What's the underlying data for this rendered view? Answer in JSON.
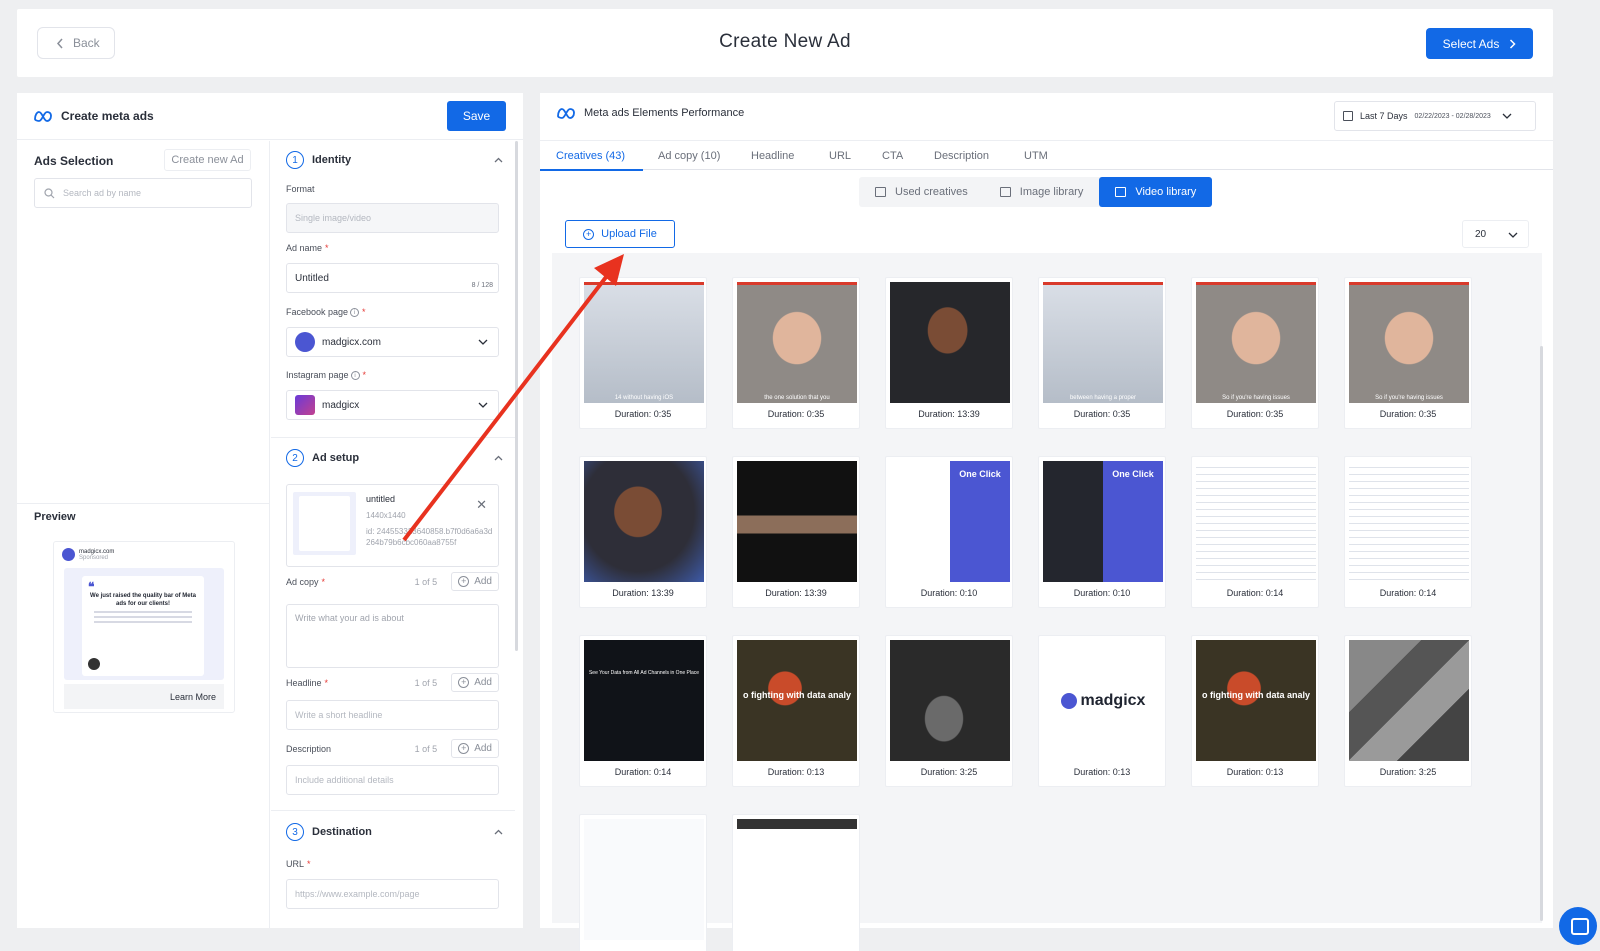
{
  "header": {
    "back_label": "Back",
    "title": "Create New Ad",
    "select_ads_label": "Select Ads"
  },
  "left_panel": {
    "title": "Create meta ads",
    "save_label": "Save",
    "ads_selection_label": "Ads Selection",
    "create_new_label": "Create new Ad",
    "search_placeholder": "Search ad by name",
    "preview_label": "Preview",
    "preview": {
      "page_name": "madgicx.com",
      "sub": "Sponsored",
      "headline": "We just raised the quality bar of Meta ads for our clients!",
      "learn_more": "Learn More"
    }
  },
  "form": {
    "identity": {
      "num": "1",
      "title": "Identity",
      "format_label": "Format",
      "format_value": "Single image/video",
      "ad_name_label": "Ad name",
      "ad_name_value": "Untitled",
      "ad_name_counter": "8 / 128",
      "facebook_label": "Facebook page",
      "facebook_value": "madgicx.com",
      "instagram_label": "Instagram page",
      "instagram_value": "madgicx"
    },
    "ad_setup": {
      "num": "2",
      "title": "Ad setup",
      "creative": {
        "name": "untitled",
        "size": "1440x1440",
        "id": "id: 244553323640858.b7f0d6a6a3d264b79b6cbc060aa8755f"
      },
      "ad_copy_label": "Ad copy",
      "ad_copy_count": "1 of 5",
      "ad_copy_placeholder": "Write what your ad is about",
      "headline_label": "Headline",
      "headline_count": "1 of 5",
      "headline_placeholder": "Write a short headline",
      "description_label": "Description",
      "description_count": "1 of 5",
      "description_placeholder": "Include additional details",
      "add_label": "Add"
    },
    "destination": {
      "num": "3",
      "title": "Destination",
      "url_label": "URL",
      "url_placeholder": "https://www.example.com/page"
    }
  },
  "right_panel": {
    "title": "Meta ads Elements Performance",
    "date_label": "Last 7 Days",
    "date_range": "02/22/2023 - 02/28/2023",
    "tabs": [
      "Creatives (43)",
      "Ad copy (10)",
      "Headline",
      "URL",
      "CTA",
      "Description",
      "UTM"
    ],
    "active_tab": "Creatives (43)",
    "segments": [
      "Used creatives",
      "Image library",
      "Video library"
    ],
    "active_segment": "Video library",
    "upload_label": "Upload File",
    "per_page": "20",
    "videos": [
      {
        "duration": "Duration: 0:35",
        "thumb": "t-sheet",
        "caption": "14 without having iOS"
      },
      {
        "duration": "Duration: 0:35",
        "thumb": "t-man",
        "caption": "the one solution that you"
      },
      {
        "duration": "Duration: 13:39",
        "thumb": "t-mk",
        "caption": ""
      },
      {
        "duration": "Duration: 0:35",
        "thumb": "t-sheet",
        "caption": "between having a proper"
      },
      {
        "duration": "Duration: 0:35",
        "thumb": "t-man",
        "caption": "So if you're having issues"
      },
      {
        "duration": "Duration: 0:35",
        "thumb": "t-man",
        "caption": "So if you're having issues"
      },
      {
        "duration": "Duration: 13:39",
        "thumb": "t-mk2",
        "caption": ""
      },
      {
        "duration": "Duration: 13:39",
        "thumb": "t-strip",
        "caption": ""
      },
      {
        "duration": "Duration: 0:10",
        "thumb": "t-purple",
        "caption": "One Click"
      },
      {
        "duration": "Duration: 0:10",
        "thumb": "t-purple2",
        "caption": "One Click"
      },
      {
        "duration": "Duration: 0:14",
        "thumb": "t-grid",
        "caption": ""
      },
      {
        "duration": "Duration: 0:14",
        "thumb": "t-grid",
        "caption": ""
      },
      {
        "duration": "Duration: 0:14",
        "thumb": "t-slide",
        "caption": "See Your Data from All Ad Channels in One Place"
      },
      {
        "duration": "Duration: 0:13",
        "thumb": "t-art",
        "caption": "o fighting with data analy"
      },
      {
        "duration": "Duration: 3:25",
        "thumb": "t-bw",
        "caption": ""
      },
      {
        "duration": "Duration: 0:13",
        "thumb": "t-logo",
        "caption": "madgicx"
      },
      {
        "duration": "Duration: 0:13",
        "thumb": "t-art",
        "caption": "o fighting with data analy"
      },
      {
        "duration": "Duration: 3:25",
        "thumb": "t-gray",
        "caption": ""
      },
      {
        "duration": "",
        "thumb": "t-light",
        "caption": ""
      },
      {
        "duration": "",
        "thumb": "t-web",
        "caption": ""
      }
    ]
  },
  "colors": {
    "accent": "#1269e6",
    "arrow": "#e8321f"
  }
}
